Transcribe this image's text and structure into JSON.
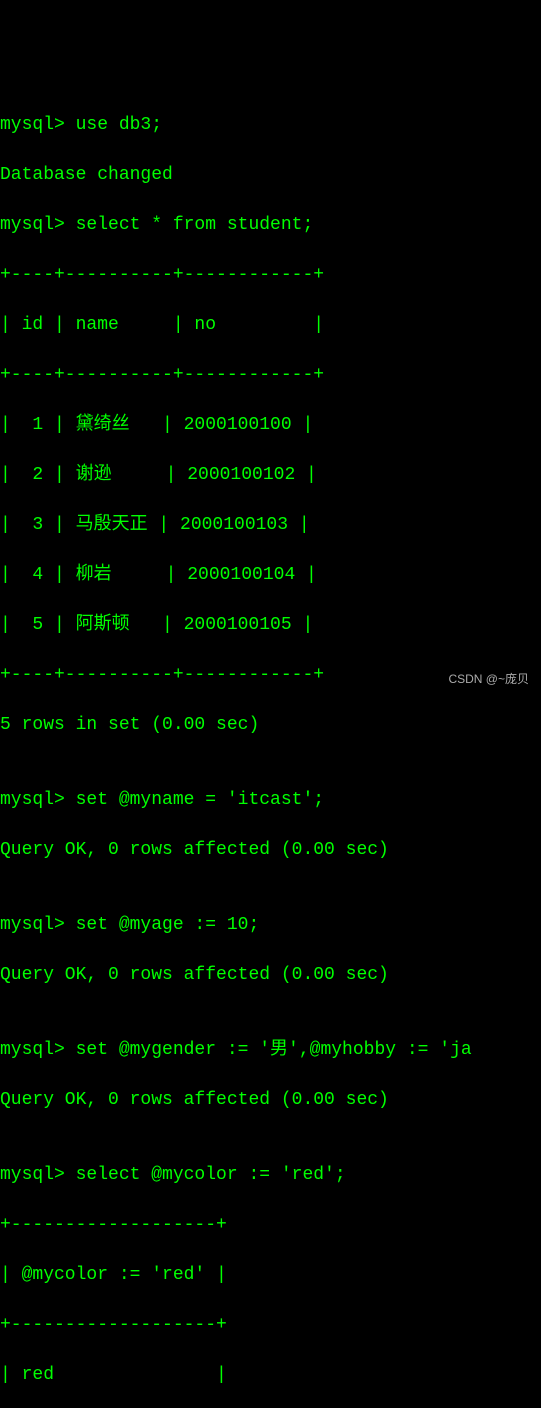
{
  "lines": {
    "l0": "mysql> use db3;",
    "l1": "Database changed",
    "l2": "mysql> select * from student;",
    "l3": "+----+----------+------------+",
    "l4": "| id | name     | no         |",
    "l5": "+----+----------+------------+",
    "l6": "|  1 | 黛绮丝   | 2000100100 |",
    "l7": "|  2 | 谢逊     | 2000100102 |",
    "l8": "|  3 | 马殷天正 | 2000100103 |",
    "l9": "|  4 | 柳岩     | 2000100104 |",
    "l10": "|  5 | 阿斯顿   | 2000100105 |",
    "l11": "+----+----------+------------+",
    "l12": "5 rows in set (0.00 sec)",
    "l13": "",
    "l14": "mysql> set @myname = 'itcast';",
    "l15": "Query OK, 0 rows affected (0.00 sec)",
    "l16": "",
    "l17": "mysql> set @myage := 10;",
    "l18": "Query OK, 0 rows affected (0.00 sec)",
    "l19": "",
    "l20": "mysql> set @mygender := '男',@myhobby := 'ja",
    "l21": "Query OK, 0 rows affected (0.00 sec)",
    "l22": "",
    "l23": "mysql> select @mycolor := 'red';",
    "l24": "+-------------------+",
    "l25": "| @mycolor := 'red' |",
    "l26": "+-------------------+",
    "l27": "| red               |"
  },
  "watermark": "CSDN @~庞贝"
}
